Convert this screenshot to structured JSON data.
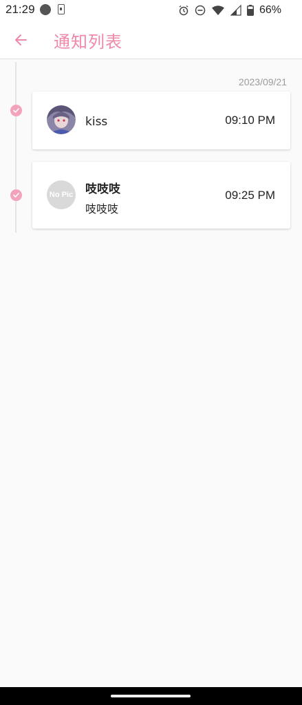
{
  "status_bar": {
    "time": "21:29",
    "battery_percent": "66%",
    "icons": [
      "notification-dot-icon",
      "sim-card-icon",
      "alarm-icon",
      "do-not-disturb-icon",
      "wifi-icon",
      "cell-signal-icon",
      "battery-icon"
    ]
  },
  "app_bar": {
    "back_icon": "arrow-left-icon",
    "title": "通知列表"
  },
  "timeline": {
    "date": "2023/09/21",
    "items": [
      {
        "name": "kiss",
        "message": "",
        "time": "09:10 PM",
        "avatar": "photo"
      },
      {
        "name": "吱吱吱",
        "message": "吱吱吱",
        "time": "09:25 PM",
        "avatar_text": "No Pic"
      }
    ]
  },
  "colors": {
    "accent": "#f088a8",
    "check_dot": "#f4a3bc",
    "background": "#fafafa"
  }
}
